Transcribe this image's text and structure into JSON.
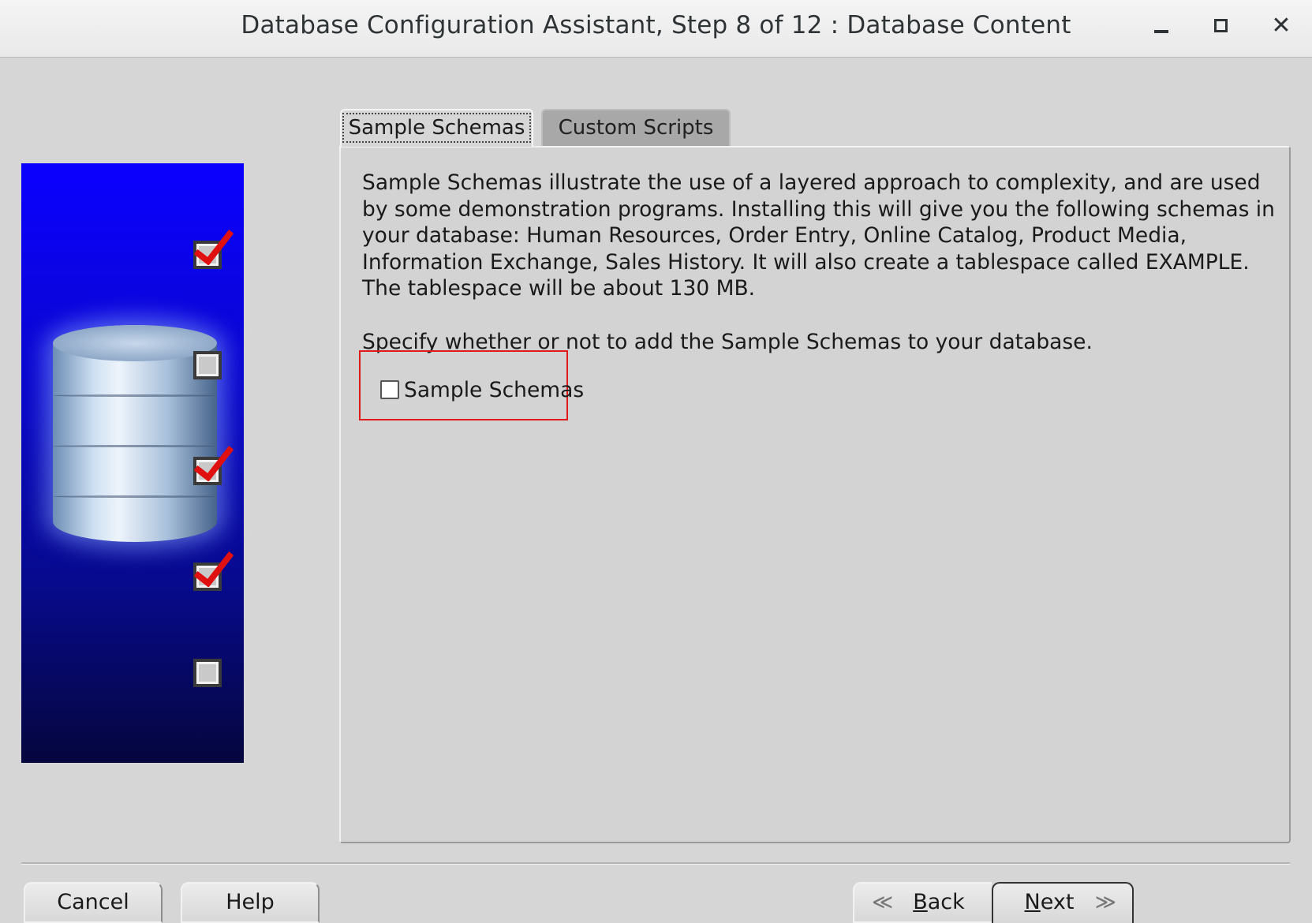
{
  "window": {
    "title": "Database Configuration Assistant, Step 8 of 12 : Database Content",
    "minimize_icon": "minimize-icon",
    "maximize_icon": "maximize-icon",
    "close_icon": "close-icon",
    "close_glyph": "✕"
  },
  "tabs": [
    {
      "label": "Sample Schemas",
      "selected": true
    },
    {
      "label": "Custom Scripts",
      "selected": false
    }
  ],
  "panel": {
    "description": "Sample Schemas illustrate the use of a layered approach to complexity, and are used by some demonstration programs. Installing this will give you the following schemas in your database: Human Resources, Order Entry, Online Catalog, Product Media, Information Exchange, Sales History. It will also create a tablespace called EXAMPLE. The tablespace will be about 130 MB.",
    "specify_text": "Specify whether or not to add the Sample Schemas to your database.",
    "checkbox": {
      "label": "Sample Schemas",
      "checked": false
    }
  },
  "side_image": {
    "checks": [
      true,
      false,
      true,
      true,
      false
    ],
    "highlight_color": "#e11b1b"
  },
  "buttons": {
    "cancel": "Cancel",
    "help": "Help",
    "back": "Back",
    "next": "Next",
    "back_chevron": "≪",
    "next_chevron": "≫"
  }
}
